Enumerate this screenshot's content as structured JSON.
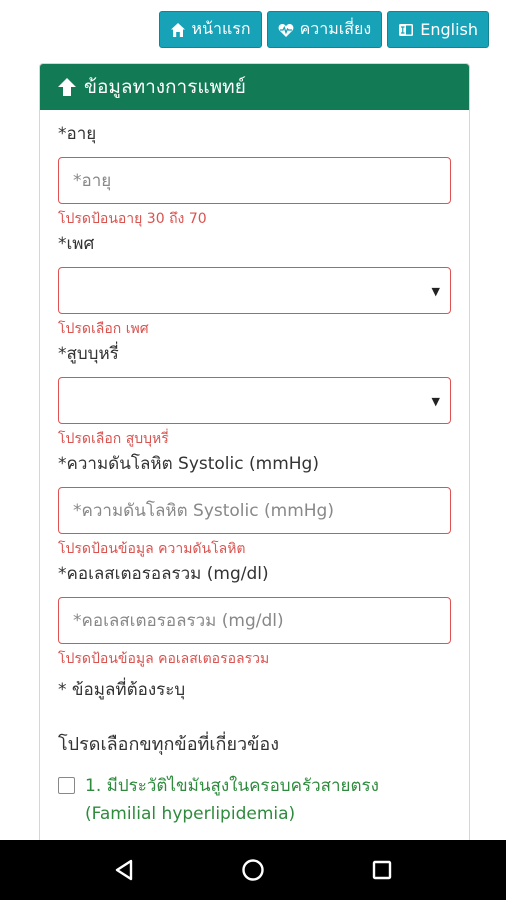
{
  "topnav": {
    "home_label": "หน้าแรก",
    "risk_label": "ความเสี่ยง",
    "english_label": "English"
  },
  "card": {
    "title": "ข้อมูลทางการแพทย์"
  },
  "form": {
    "age": {
      "label": "*อายุ",
      "placeholder": "*อายุ",
      "error": "โปรดป้อนอายุ 30 ถึง 70"
    },
    "sex": {
      "label": "*เพศ",
      "value": "",
      "error": "โปรดเลือก เพศ"
    },
    "smoking": {
      "label": "*สูบบุหรี่",
      "value": "",
      "error": "โปรดเลือก สูบบุหรี่"
    },
    "systolic": {
      "label": "*ความดันโลหิต Systolic (mmHg)",
      "placeholder": "*ความดันโลหิต Systolic  (mmHg)",
      "error": "โปรดป้อนข้อมูล ความดันโลหิต"
    },
    "cholesterol": {
      "label": "*คอเลสเตอรอลรวม (mg/dl)",
      "placeholder": "*คอเลสเตอรอลรวม (mg/dl)",
      "error": "โปรดป้อนข้อมูล คอเลสเตอรอลรวม"
    },
    "required_note": "* ข้อมูลที่ต้องระบุ",
    "instruction": "โปรดเลือกขทุกข้อที่เกี่ยวข้อง",
    "checkbox_1": {
      "label_line1": "1. มีประวัติไขมันสูงในครอบครัวสายตรง",
      "label_line2": "(Familial hyperlipidemia)",
      "checked": false
    }
  },
  "colors": {
    "nav_button": "#17a2b8",
    "card_header": "#137a56",
    "error": "#d9534f",
    "checkbox_label": "#2e8b3d"
  },
  "icons": {
    "home": "home-icon",
    "risk": "heartbeat-icon",
    "english": "language-icon",
    "header": "arrow-up-icon",
    "back": "back-triangle-icon",
    "home_nav": "home-circle-icon",
    "recents": "recents-square-icon"
  }
}
